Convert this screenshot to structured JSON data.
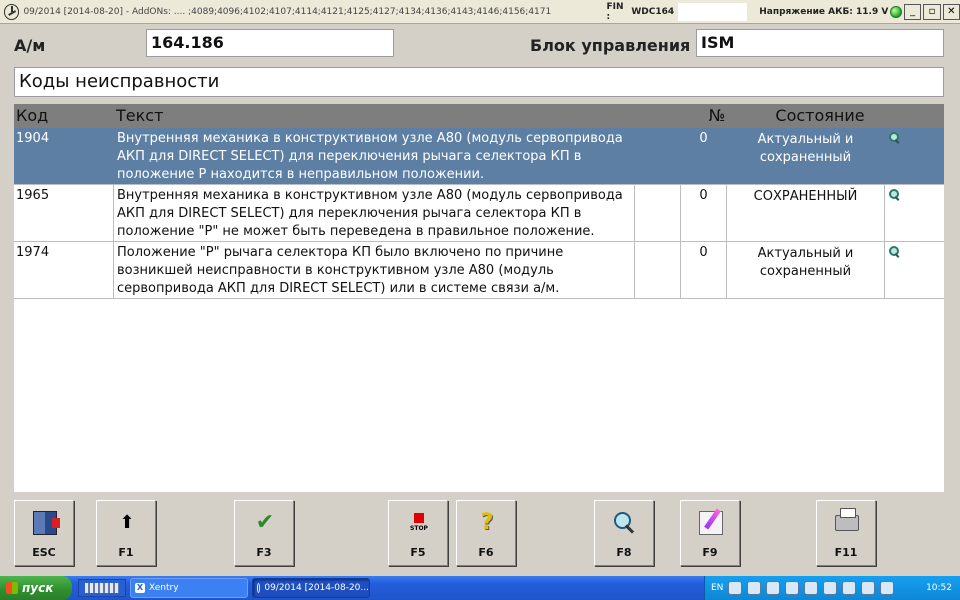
{
  "window": {
    "title": "09/2014 [2014-08-20] - AddONs:  .... ;4089;4096;4102;4107;4114;4121;4125;4127;4134;4136;4143;4146;4156;4171",
    "fin_label": "FIN :",
    "fin_value": "WDC164",
    "voltage": "Напряжение АКБ: 11.9 V",
    "minimize": "_",
    "restore": "▫",
    "close": "✕"
  },
  "header": {
    "am_label": "А/м",
    "am_value": "164.186",
    "ecu_label": "Блок управления",
    "ecu_value": "ISM"
  },
  "section_title": "Коды неисправности",
  "table": {
    "columns": [
      "Код",
      "Текст",
      "№",
      "Состояние"
    ],
    "rows": [
      {
        "code": "1904",
        "text": "Внутренняя механика в конструктивном узле А80 (модуль сервопривода АКП для DIRECT SELECT) для переключения рычага селектора КП в положение P находится в неправильном положении.",
        "num": "0",
        "state": "Актуальный и сохраненный",
        "icon": "magnifier-icon",
        "selected": true
      },
      {
        "code": "1965",
        "text": "Внутренняя механика в конструктивном узле А80 (модуль сервопривода АКП для DIRECT SELECT) для переключения рычага селектора КП в положение \"P\" не может быть переведена в правильное положение.",
        "num": "0",
        "state": "СОХРАНЕННЫЙ",
        "icon": "magnifier-icon",
        "selected": false
      },
      {
        "code": "1974",
        "text": "Положение \"P\" рычага селектора КП было включено по причине возникшей неисправности в конструктивном узле А80 (модуль сервопривода АКП для DIRECT SELECT) или в системе связи а/м.",
        "num": "0",
        "state": "Актуальный и сохраненный",
        "icon": "magnifier-icon",
        "selected": false
      }
    ]
  },
  "function_keys": [
    {
      "label": "ESC",
      "icon": "exit-door-icon"
    },
    {
      "label": "F1",
      "icon": "arrow-up-icon"
    },
    {
      "label": "F3",
      "icon": "checkmark-icon"
    },
    {
      "label": "F5",
      "icon": "stop-icon"
    },
    {
      "label": "F6",
      "icon": "help-icon"
    },
    {
      "label": "F8",
      "icon": "magnifier-icon"
    },
    {
      "label": "F9",
      "icon": "edit-icon"
    },
    {
      "label": "F11",
      "icon": "printer-icon"
    }
  ],
  "taskbar": {
    "start_label": "пуск",
    "tasks": [
      "Xentry",
      "09/2014 [2014-08-20..."
    ],
    "lang": "EN",
    "time": "10:52"
  },
  "colors": {
    "selected_row": "#5d7fa3",
    "table_header": "#7e7e7e",
    "taskbar": "#245edc",
    "start_button": "#2e8e2e",
    "tray": "#0f86d6"
  }
}
